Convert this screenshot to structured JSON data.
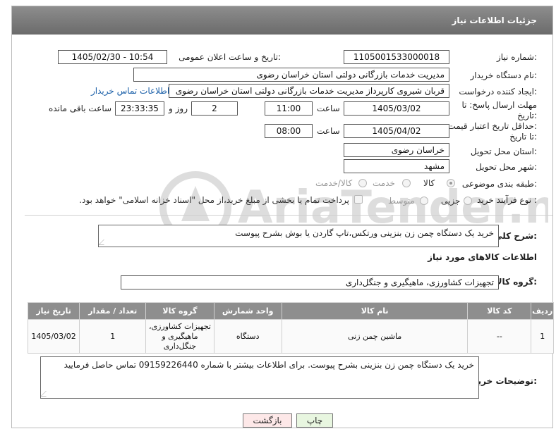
{
  "header": {
    "title": "جزئیات اطلاعات نیاز"
  },
  "fields": {
    "need_number_label": "شماره نیاز:",
    "need_number": "1105001533000018",
    "announce_label": "تاریخ و ساعت اعلان عمومی:",
    "announce_value": "1405/02/30 - 10:54",
    "buyer_org_label": "نام دستگاه خریدار:",
    "buyer_org": "مدیریت خدمات بازرگانی دولتی استان خراسان رضوی",
    "requester_label": "ایجاد کننده درخواست:",
    "requester": "قربان شیروی کارپرداز مدیریت خدمات بازرگانی دولتی استان خراسان رضوی",
    "buyer_contact_link": "اطلاعات تماس خریدار",
    "reply_deadline_label_1": "مهلت ارسال پاسخ: تا",
    "reply_deadline_label_2": "تاریخ:",
    "reply_date": "1405/03/02",
    "time_label": "ساعت",
    "reply_time": "11:00",
    "days_value": "2",
    "days_label": "روز و",
    "remaining_value": "23:33:35",
    "remaining_label": "ساعت باقی مانده",
    "price_deadline_label_1": "حداقل تاریخ اعتبار قیمت:",
    "price_deadline_label_2": "تا تاریخ:",
    "price_date": "1405/04/02",
    "price_time_label": "ساعت",
    "price_time": "08:00",
    "province_label": "استان محل تحویل:",
    "province": "خراسان رضوی",
    "city_label": "شهر محل تحویل:",
    "city": "مشهد",
    "category_label": "طبقه بندی موضوعی:",
    "category_options": [
      "کالا",
      "خدمت",
      "کالا/خدمت"
    ],
    "category_selected": "کالا",
    "process_label": "نوع فرآیند خرید :",
    "process_options": [
      "جزیی",
      "متوسط"
    ],
    "payment_note": "پرداخت تمام یا بخشی از مبلغ خرید،از محل \"اسناد خزانه اسلامی\" خواهد بود."
  },
  "description": {
    "label": "شرح کلی نیاز:",
    "text": "خرید یک دستگاه چمن زن بنزینی ورتکس،تاپ گاردن یا بوش بشرح پیوست"
  },
  "goods_section": {
    "title": "اطلاعات کالاهای مورد نیاز",
    "group_label": "گروه کالا:",
    "group_value": "تجهیزات کشاورزی، ماهیگیری و جنگل‌داری",
    "columns": [
      "ردیف",
      "کد کالا",
      "نام کالا",
      "واحد شمارش",
      "گروه کالا",
      "تعداد / مقدار",
      "تاریخ نیاز"
    ],
    "rows": [
      {
        "row": "1",
        "code": "--",
        "name": "ماشین چمن زنی",
        "unit": "دستگاه",
        "group": "تجهیزات کشاورزی، ماهیگیری و جنگل‌داری",
        "qty": "1",
        "date": "1405/03/02"
      }
    ]
  },
  "buyer_notes": {
    "label": "توضیحات خریدار:",
    "text": "خرید یک دستگاه چمن زن بنزینی بشرح پیوست. برای اطلاعات بیشتر با شماره 09159226440 تماس حاصل فرمایید"
  },
  "buttons": {
    "print": "چاپ",
    "back": "بازگشت"
  },
  "watermark": "AriaTender.neT",
  "colors": {
    "header": "#7a7a7a",
    "link": "#1a5fa8",
    "back_button": "#fde8e8",
    "print_button": "#e8f6e0"
  }
}
